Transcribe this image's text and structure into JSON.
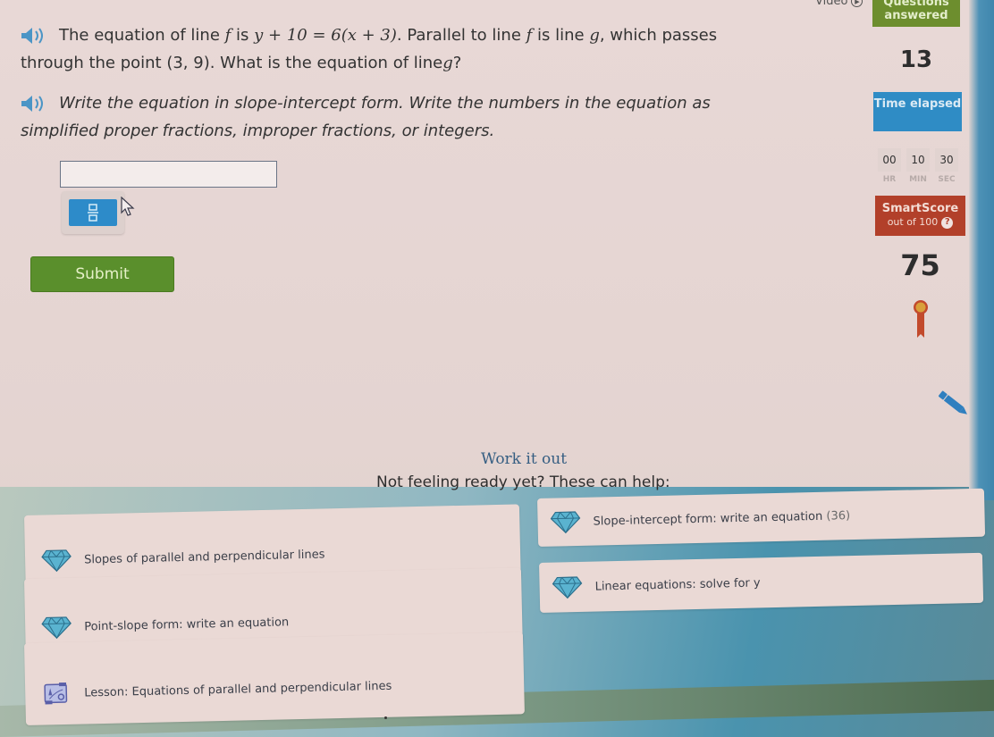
{
  "sidebar": {
    "video_label": "Video",
    "questions_answered_label": "Questions answered",
    "questions_answered_value": "13",
    "time_elapsed_label": "Time elapsed",
    "timer": {
      "hr": "00",
      "min": "10",
      "sec": "30",
      "hr_label": "HR",
      "min_label": "MIN",
      "sec_label": "SEC"
    },
    "smartscore_label": "SmartScore",
    "smartscore_sub": "out of 100",
    "smartscore_help": "?",
    "smartscore_value": "75",
    "colors": {
      "questions_answered_bg": "#6d8e2e",
      "time_elapsed_bg": "#2f8cc5",
      "smartscore_bg": "#b2402a"
    }
  },
  "question": {
    "line1_prefix": "The equation of line ",
    "line1_f": "f",
    "line1_is": " is ",
    "line1_equation": "y + 10 = 6(x + 3)",
    "line1_mid": ". Parallel to line ",
    "line1_f2": "f",
    "line1_is2": " is line ",
    "line1_g": "g",
    "line1_suffix": ", which passes",
    "line2": "through the point (3, 9). What is the equation of line ",
    "line2_g": "g",
    "line2_end": "?",
    "instruction_line1": "Write the equation in slope-intercept form. Write the numbers in the equation as",
    "instruction_line2": "simplified proper fractions, improper fractions, or integers."
  },
  "answer": {
    "value": "",
    "fraction_button_icon": "fraction-icon"
  },
  "submit_label": "Submit",
  "work_it_out": "Work it out",
  "not_ready": "Not feeling ready yet? These can help:",
  "help_cards": [
    {
      "label": "Slopes of parallel and perpendicular lines",
      "icon": "diamond-icon"
    },
    {
      "label": "Slope-intercept form: write an equation",
      "count": "(36)",
      "icon": "diamond-icon"
    },
    {
      "label": "Point-slope form: write an equation",
      "icon": "diamond-icon"
    },
    {
      "label": "Linear equations: solve for y",
      "icon": "diamond-icon"
    },
    {
      "label": "Lesson: Equations of parallel and perpendicular lines",
      "icon": "lesson-icon"
    }
  ],
  "colors": {
    "submit_bg": "#5a8f2c",
    "fraction_btn_bg": "#2d8bc9",
    "work_it_out": "#355e82"
  }
}
